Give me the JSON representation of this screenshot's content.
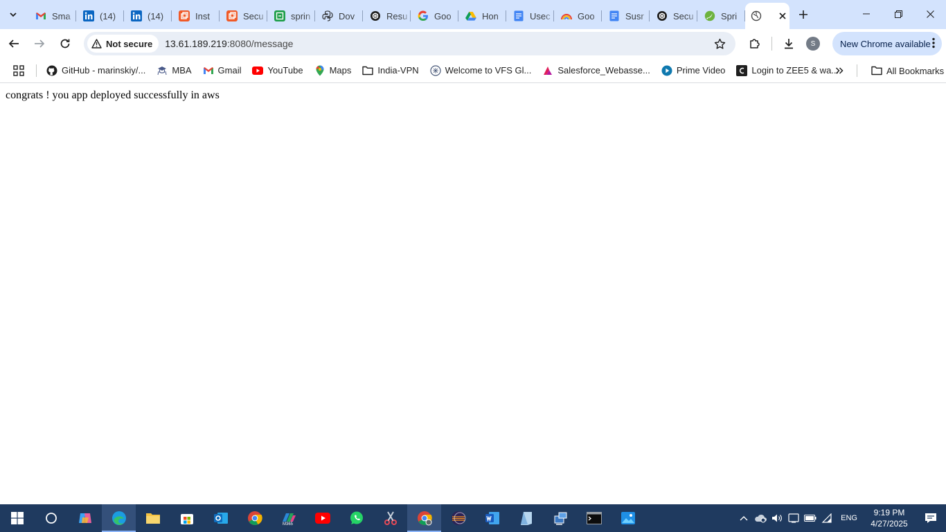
{
  "tabs": [
    {
      "title": "Sma",
      "icon": "gmail-icon"
    },
    {
      "title": "(14)",
      "icon": "linkedin-icon"
    },
    {
      "title": "(14)",
      "icon": "linkedin-icon"
    },
    {
      "title": "Inst",
      "icon": "orange-square-icon"
    },
    {
      "title": "Secu",
      "icon": "orange-square-icon"
    },
    {
      "title": "sprin",
      "icon": "green-square-icon"
    },
    {
      "title": "Dov",
      "icon": "python-icon"
    },
    {
      "title": "Resu",
      "icon": "openai-icon"
    },
    {
      "title": "Goo",
      "icon": "google-icon"
    },
    {
      "title": "Hon",
      "icon": "drive-icon"
    },
    {
      "title": "Usec",
      "icon": "docs-icon"
    },
    {
      "title": "Goo",
      "icon": "rainbow-icon"
    },
    {
      "title": "Susr",
      "icon": "docs-icon"
    },
    {
      "title": "Secu",
      "icon": "openai-icon"
    },
    {
      "title": "Spri",
      "icon": "spring-icon"
    }
  ],
  "active_tab": {
    "icon": "globe-icon"
  },
  "omnibox": {
    "security_label": "Not secure",
    "url_host": "13.61.189.219",
    "url_rest": ":8080/message"
  },
  "profile_initial": "S",
  "update_label": "New Chrome available",
  "bookmarks": [
    {
      "label": "GitHub - marinskiy/...",
      "icon": "github-icon"
    },
    {
      "label": "MBA",
      "icon": "mba-icon"
    },
    {
      "label": "Gmail",
      "icon": "gmail-icon"
    },
    {
      "label": "YouTube",
      "icon": "youtube-icon"
    },
    {
      "label": "Maps",
      "icon": "maps-icon"
    },
    {
      "label": "India-VPN",
      "icon": "folder-icon"
    },
    {
      "label": "Welcome to VFS Gl...",
      "icon": "vfs-icon"
    },
    {
      "label": "Salesforce_Webasse...",
      "icon": "salesforce-icon"
    },
    {
      "label": "Prime Video",
      "icon": "prime-icon"
    },
    {
      "label": "Login to ZEE5 & wa...",
      "icon": "zee5-icon"
    }
  ],
  "all_bookmarks_label": "All Bookmarks",
  "page": {
    "message": "congrats ! you app deployed successfully in aws"
  },
  "taskbar": {
    "language": "ENG",
    "time": "9:19 PM",
    "date": "4/27/2025"
  }
}
